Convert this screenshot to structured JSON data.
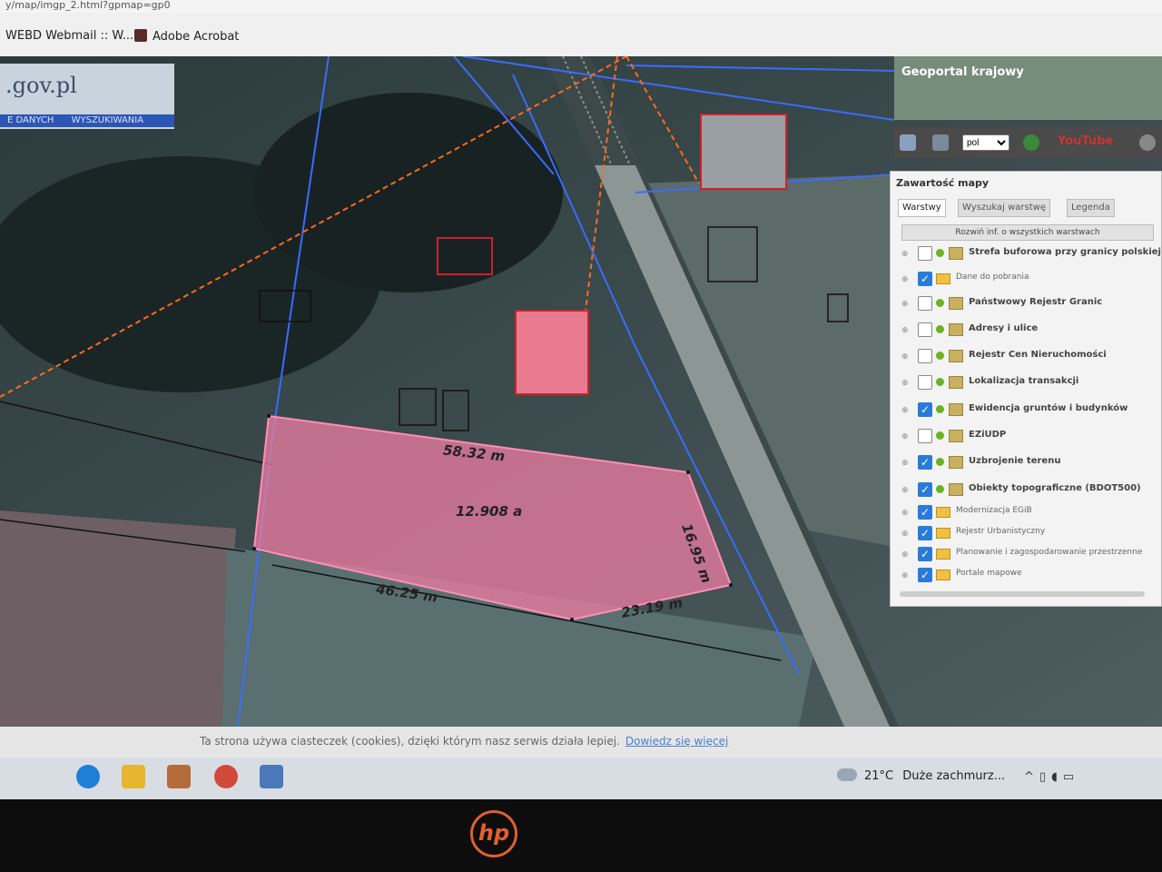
{
  "browser": {
    "url": "y/map/imgp_2.html?gpmap=gp0",
    "bookmarks": [
      {
        "label": "WEBD Webmail :: W...",
        "icon": "webmail-icon"
      },
      {
        "label": "Adobe Acrobat",
        "icon": "acrobat-icon"
      }
    ]
  },
  "site": {
    "logo_text": ".gov.pl",
    "nav_tabs": [
      "E DANYCH",
      "WYSZUKIWANIA"
    ]
  },
  "geoportal": {
    "label": "Geoportal krajowy",
    "language": "pol",
    "youtube_label": "YouTube"
  },
  "panel": {
    "title": "Zawartość mapy",
    "tabs": [
      "Warstwy",
      "Wyszukaj warstwę",
      "Legenda"
    ],
    "info_button": "Rozwiń inf. o wszystkich warstwach",
    "layers": [
      {
        "name": "Strefa buforowa przy granicy polskiej",
        "checked": false,
        "type": "layer"
      },
      {
        "name": "Dane do pobrania",
        "checked": true,
        "type": "group"
      },
      {
        "name": "Państwowy Rejestr Granic",
        "checked": false,
        "type": "layer"
      },
      {
        "name": "Adresy i ulice",
        "checked": false,
        "type": "layer"
      },
      {
        "name": "Rejestr Cen Nieruchomości",
        "checked": false,
        "type": "layer"
      },
      {
        "name": "Lokalizacja transakcji",
        "checked": false,
        "type": "layer"
      },
      {
        "name": "Ewidencja gruntów i budynków",
        "checked": true,
        "type": "layer"
      },
      {
        "name": "EZiUDP",
        "checked": false,
        "type": "layer"
      },
      {
        "name": "Uzbrojenie terenu",
        "checked": true,
        "type": "layer"
      },
      {
        "name": "Obiekty topograficzne (BDOT500)",
        "checked": true,
        "type": "layer"
      },
      {
        "name": "Modernizacja EGiB",
        "checked": true,
        "type": "group"
      },
      {
        "name": "Rejestr Urbanistyczny",
        "checked": true,
        "type": "group"
      },
      {
        "name": "Planowanie i zagospodarowanie przestrzenne",
        "checked": true,
        "type": "group"
      },
      {
        "name": "Portale mapowe",
        "checked": true,
        "type": "group"
      }
    ]
  },
  "map_labels": {
    "top_edge": "58.32 m",
    "area": "12.908 a",
    "right_edge": "16.95 m",
    "bottom_left_edge": "46.25 m",
    "bottom_right_edge": "23.19 m"
  },
  "cookie_bar": {
    "text": "Ta strona używa ciasteczek (cookies), dzięki którym nasz serwis działa lepiej.",
    "link": "Dowiedz się więcej"
  },
  "taskbar": {
    "weather_temp": "21°C",
    "weather_desc": "Duże zachmurz..."
  },
  "device": {
    "brand": "hp"
  },
  "colors": {
    "parcel_fill": "#e87ba0",
    "parcel_border": "#ff8fb5",
    "boundary_line": "#3a6cff",
    "building_outline": "#d0202a",
    "utility_line": "#ff6a20",
    "link": "#4b7fd0"
  }
}
